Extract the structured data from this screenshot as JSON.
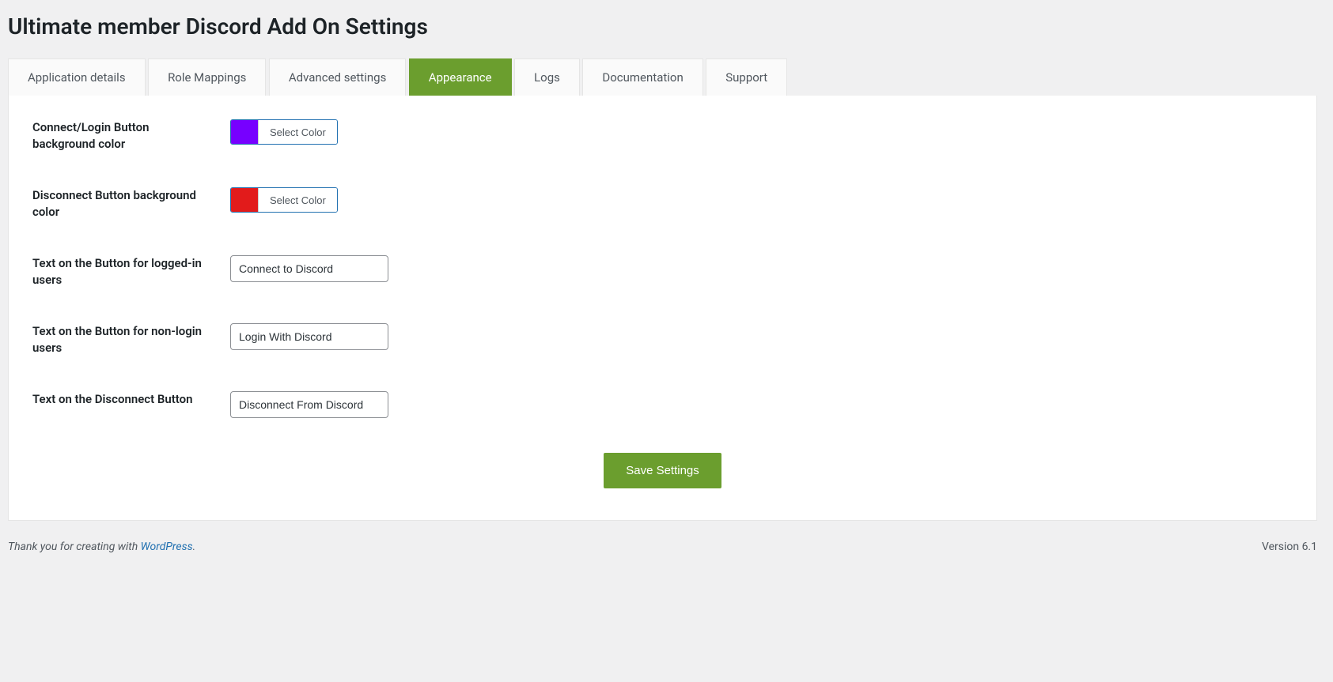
{
  "page_title": "Ultimate member Discord Add On Settings",
  "tabs": [
    {
      "label": "Application details",
      "active": false
    },
    {
      "label": "Role Mappings",
      "active": false
    },
    {
      "label": "Advanced settings",
      "active": false
    },
    {
      "label": "Appearance",
      "active": true
    },
    {
      "label": "Logs",
      "active": false
    },
    {
      "label": "Documentation",
      "active": false
    },
    {
      "label": "Support",
      "active": false
    }
  ],
  "fields": {
    "connect_bg_color": {
      "label": "Connect/Login Button background color",
      "swatch": "#7700ff",
      "button_text": "Select Color"
    },
    "disconnect_bg_color": {
      "label": "Disconnect Button background color",
      "swatch": "#e21b1b",
      "button_text": "Select Color"
    },
    "text_logged_in": {
      "label": "Text on the Button for logged-in users",
      "value": "Connect to Discord"
    },
    "text_non_login": {
      "label": "Text on the Button for non-login users",
      "value": "Login With Discord"
    },
    "text_disconnect": {
      "label": "Text on the Disconnect Button",
      "value": "Disconnect From Discord"
    }
  },
  "save_button": "Save Settings",
  "footer": {
    "thank_you_prefix": "Thank you for creating with ",
    "link_text": "WordPress",
    "suffix": ".",
    "version": "Version 6.1"
  }
}
